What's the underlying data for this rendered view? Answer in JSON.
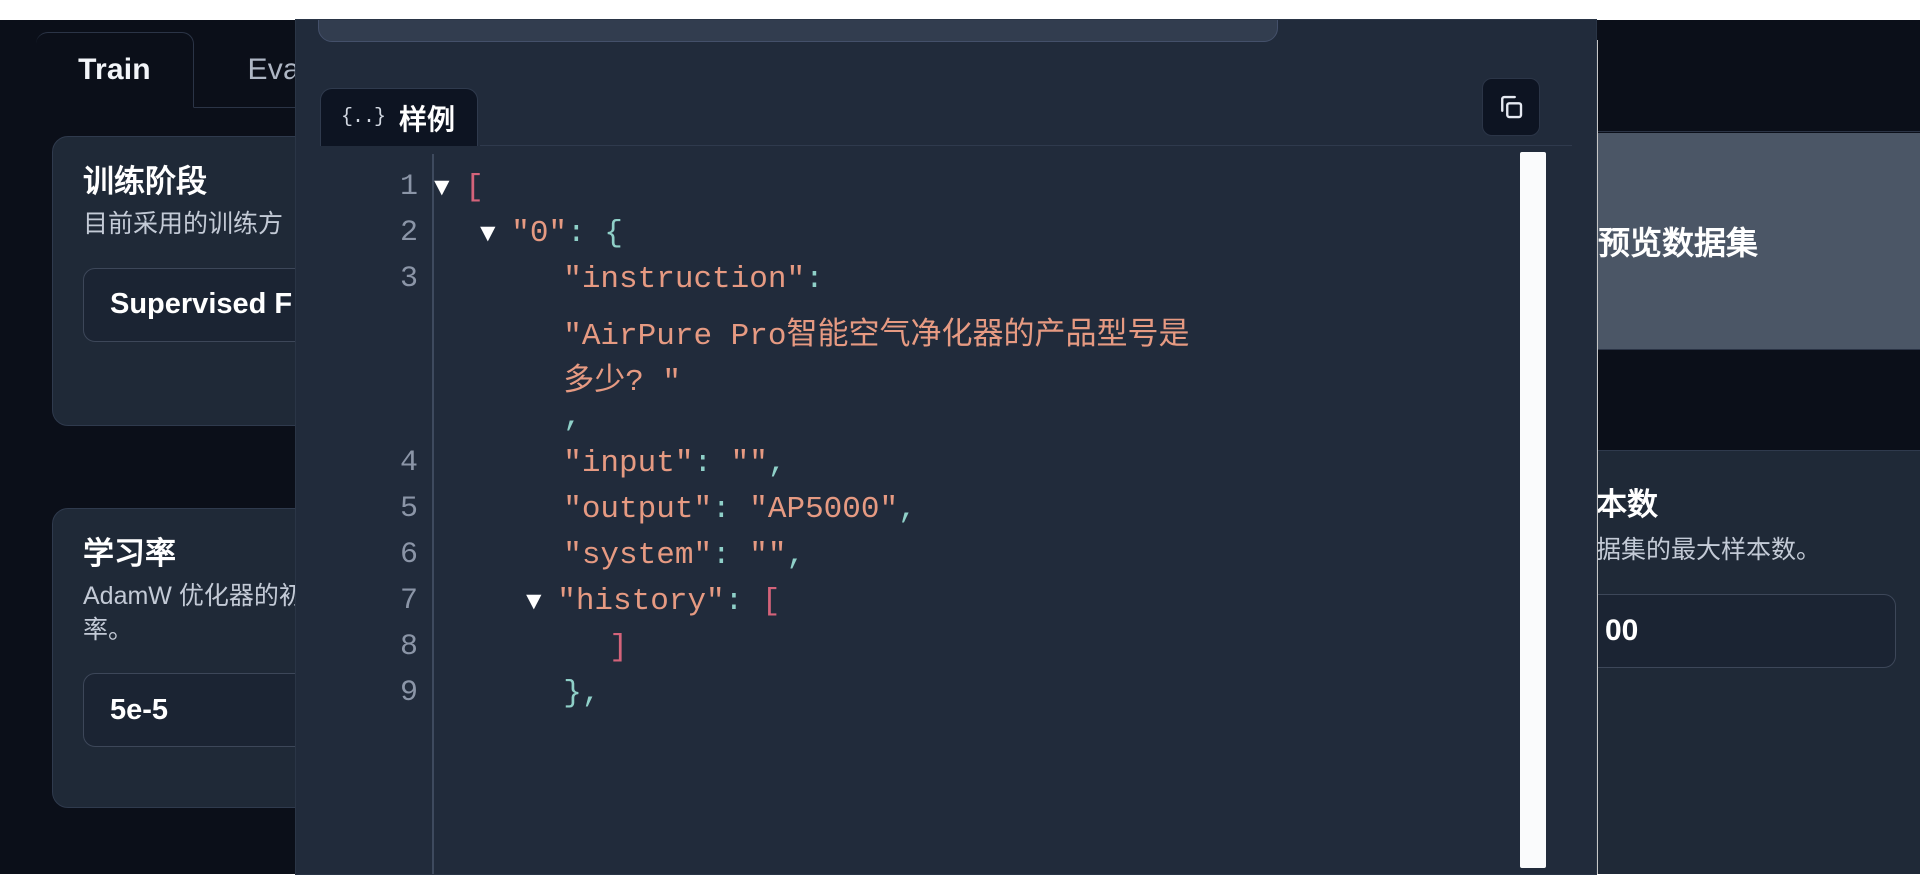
{
  "background": {
    "tabs": [
      {
        "label": "Train",
        "active": true
      },
      {
        "label": "Evalua",
        "active": false
      }
    ],
    "cards": [
      {
        "title": "训练阶段",
        "desc": "目前采用的训练方",
        "value": "Supervised F"
      },
      {
        "title": "学习率",
        "desc": "AdamW 优化器的初\n率。",
        "value": "5e-5"
      }
    ],
    "right_panel": {
      "preview_button": "预览数据集",
      "card_title": "本数",
      "card_desc": "据集的最大样本数。",
      "card_value": "00"
    }
  },
  "modal": {
    "tab": {
      "icon": "{..}",
      "label": "样例"
    },
    "copy_icon": "copy-icon",
    "code": {
      "lines": [
        {
          "num": "1",
          "indent": 0,
          "caret": true,
          "segments": [
            {
              "t": "[",
              "c": "tok-brkt"
            }
          ]
        },
        {
          "num": "2",
          "indent": 1,
          "caret": true,
          "segments": [
            {
              "t": "\"0\"",
              "c": "tok-key"
            },
            {
              "t": ": ",
              "c": "tok-punct"
            },
            {
              "t": "{",
              "c": "tok-punct"
            }
          ]
        },
        {
          "num": "3",
          "indent": 2,
          "caret": false,
          "segments": [
            {
              "t": "\"instruction\"",
              "c": "tok-key"
            },
            {
              "t": ":",
              "c": "tok-punct"
            }
          ]
        },
        {
          "num": "",
          "indent": 2,
          "caret": false,
          "segments": [
            {
              "t": "\"AirPure Pro智能空气净化器的产品型号是",
              "c": "tok-str"
            }
          ]
        },
        {
          "num": "",
          "indent": 2,
          "caret": false,
          "segments": [
            {
              "t": "多少? \"",
              "c": "tok-str"
            }
          ]
        },
        {
          "num": "",
          "indent": 2,
          "caret": false,
          "segments": [
            {
              "t": ",",
              "c": "tok-punct"
            }
          ]
        },
        {
          "num": "4",
          "indent": 2,
          "caret": false,
          "segments": [
            {
              "t": "\"input\"",
              "c": "tok-key"
            },
            {
              "t": ": ",
              "c": "tok-punct"
            },
            {
              "t": "\"\"",
              "c": "tok-str"
            },
            {
              "t": ",",
              "c": "tok-punct"
            }
          ]
        },
        {
          "num": "5",
          "indent": 2,
          "caret": false,
          "segments": [
            {
              "t": "\"output\"",
              "c": "tok-key"
            },
            {
              "t": ": ",
              "c": "tok-punct"
            },
            {
              "t": "\"AP5000\"",
              "c": "tok-str"
            },
            {
              "t": ",",
              "c": "tok-punct"
            }
          ]
        },
        {
          "num": "6",
          "indent": 2,
          "caret": false,
          "segments": [
            {
              "t": "\"system\"",
              "c": "tok-key"
            },
            {
              "t": ": ",
              "c": "tok-punct"
            },
            {
              "t": "\"\"",
              "c": "tok-str"
            },
            {
              "t": ",",
              "c": "tok-punct"
            }
          ]
        },
        {
          "num": "7",
          "indent": 2,
          "caret": true,
          "segments": [
            {
              "t": "\"history\"",
              "c": "tok-key"
            },
            {
              "t": ": ",
              "c": "tok-punct"
            },
            {
              "t": "[",
              "c": "tok-brkt"
            }
          ]
        },
        {
          "num": "8",
          "indent": 3,
          "caret": false,
          "segments": [
            {
              "t": "]",
              "c": "tok-brkt"
            }
          ]
        },
        {
          "num": "9",
          "indent": 2,
          "caret": false,
          "segments": [
            {
              "t": "}",
              "c": "tok-punct"
            },
            {
              "t": ",",
              "c": "tok-punct"
            }
          ]
        }
      ]
    }
  },
  "colors": {
    "app_bg": "#0b0f19",
    "card_bg": "#1f2937",
    "modal_bg": "#212b3b",
    "code_bg": "#212b3b",
    "key": "#e69a82",
    "string": "#e69a82",
    "punct": "#8fd0c8",
    "bracket": "#d4637a",
    "scrollbar": "#c6c6c6"
  }
}
